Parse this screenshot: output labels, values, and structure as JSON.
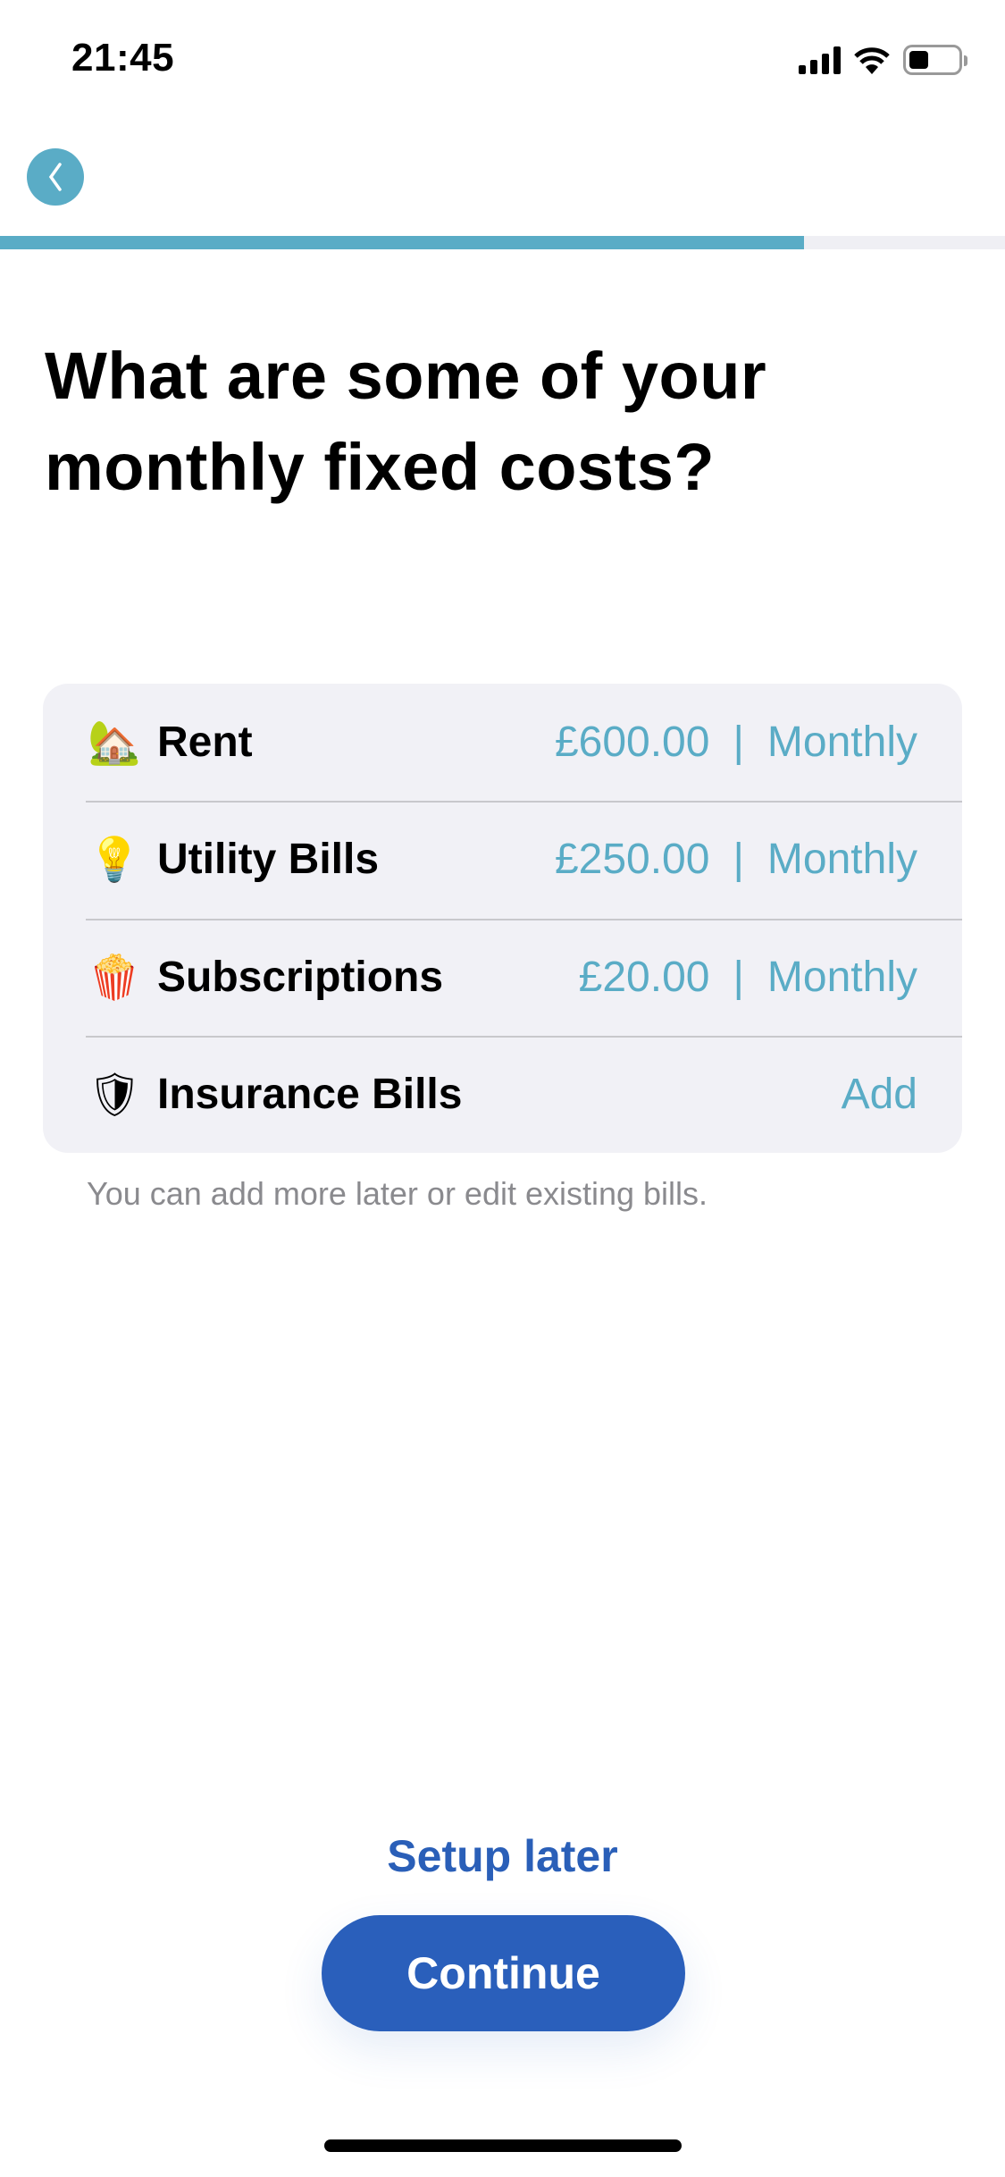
{
  "status_bar": {
    "time": "21:45",
    "battery_level": 0.4
  },
  "header": {
    "back_icon": "chevron-left-icon",
    "progress": 0.8,
    "accent": "#5aacc6"
  },
  "title": "What are some of your monthly fixed costs?",
  "bills": [
    {
      "icon": "house-with-garden-emoji",
      "emoji": "🏡",
      "label": "Rent",
      "amount": "£600.00",
      "separator": "|",
      "frequency": "Monthly"
    },
    {
      "icon": "light-bulb-emoji",
      "emoji": "💡",
      "label": "Utility Bills",
      "amount": "£250.00",
      "separator": "|",
      "frequency": "Monthly"
    },
    {
      "icon": "popcorn-emoji",
      "emoji": "🍿",
      "label": "Subscriptions",
      "amount": "£20.00",
      "separator": "|",
      "frequency": "Monthly"
    },
    {
      "icon": "shield-emoji",
      "emoji": "🛡",
      "label": "Insurance Bills",
      "action": "Add"
    }
  ],
  "helper_text": "You can add more later or edit existing bills.",
  "footer": {
    "setup_later": "Setup later",
    "continue": "Continue",
    "primary_color": "#2a5fbb"
  }
}
